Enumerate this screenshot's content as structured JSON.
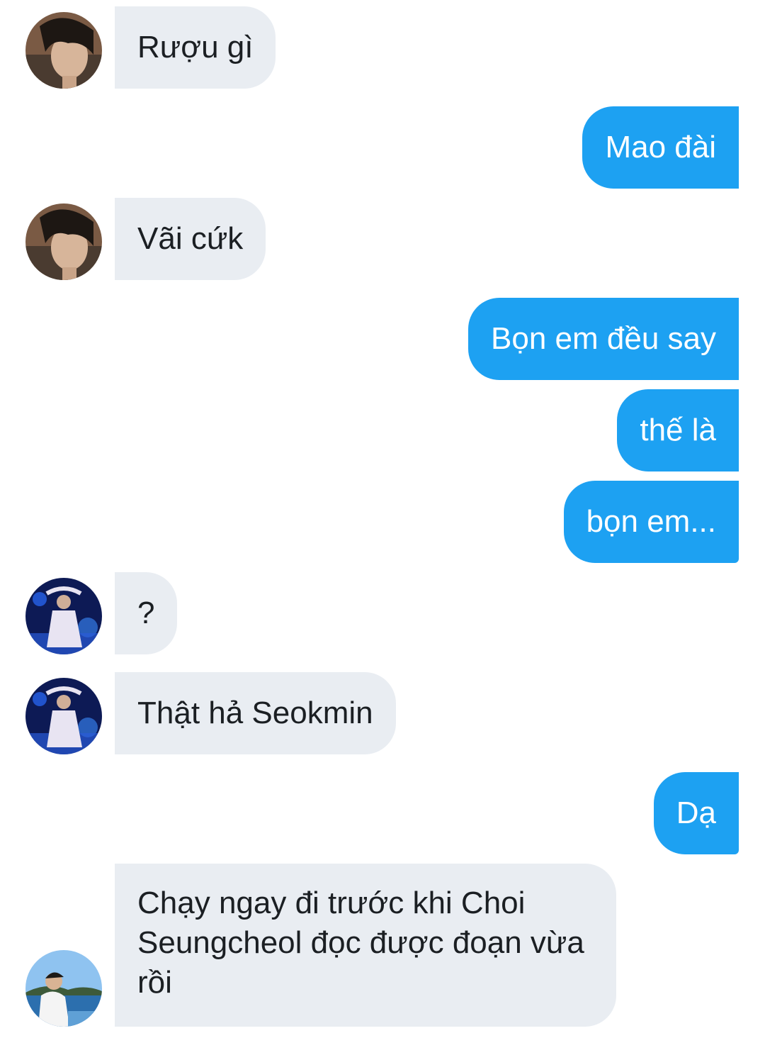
{
  "messages": [
    {
      "sender": "them",
      "text": "Rượu gì",
      "avatar": "avatar-a"
    },
    {
      "sender": "me",
      "text": "Mao đài"
    },
    {
      "sender": "them",
      "text": "Vãi cứk",
      "avatar": "avatar-a"
    },
    {
      "sender": "me",
      "text": "Bọn em đều say"
    },
    {
      "sender": "me",
      "text": "thế là"
    },
    {
      "sender": "me",
      "text": "bọn em..."
    },
    {
      "sender": "them",
      "text": "?",
      "avatar": "avatar-b"
    },
    {
      "sender": "them",
      "text": "Thật hả Seokmin",
      "avatar": "avatar-b"
    },
    {
      "sender": "me",
      "text": "Dạ"
    },
    {
      "sender": "them",
      "text": "Chạy ngay đi trước khi Choi Seungcheol đọc được đoạn vừa rồi",
      "avatar": "avatar-c"
    }
  ],
  "colors": {
    "incoming_bubble": "#e9edf2",
    "outgoing_bubble": "#1da1f2",
    "incoming_text": "#1b1f23",
    "outgoing_text": "#ffffff",
    "background": "#ffffff"
  }
}
